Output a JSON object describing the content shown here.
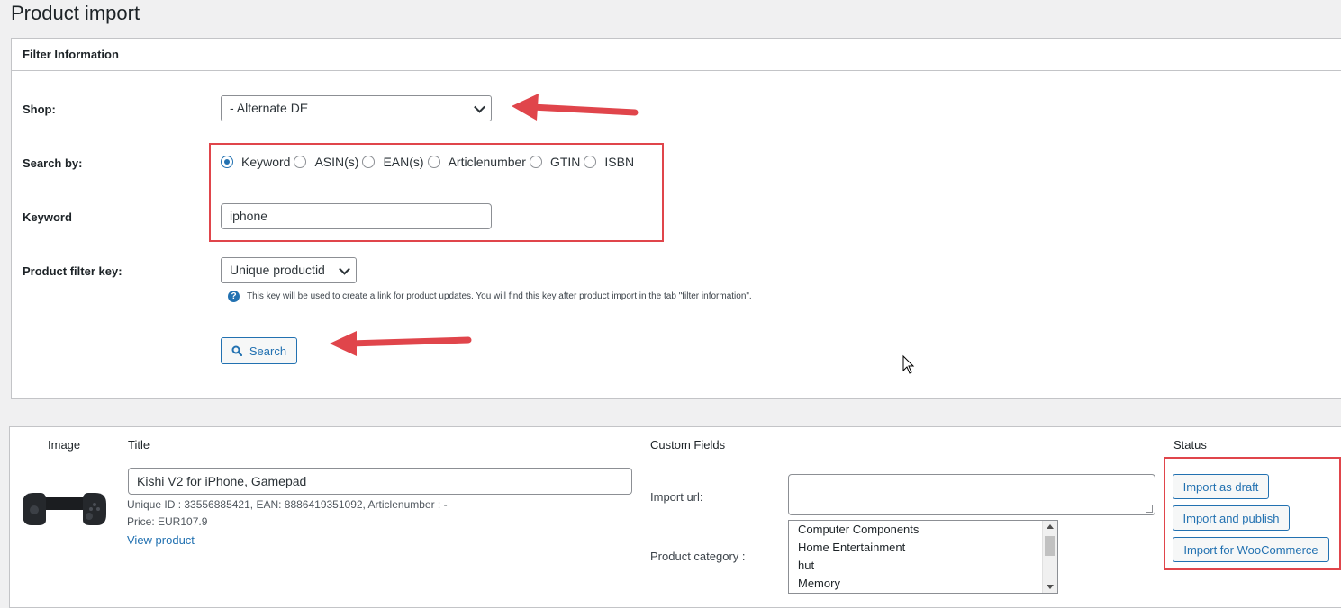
{
  "page": {
    "title": "Product import"
  },
  "filter": {
    "header": "Filter Information",
    "shop_label": "Shop:",
    "shop_value": "- Alternate DE",
    "search_by_label": "Search by:",
    "search_options": [
      {
        "label": "Keyword",
        "checked": true
      },
      {
        "label": "ASIN(s)",
        "checked": false
      },
      {
        "label": "EAN(s)",
        "checked": false
      },
      {
        "label": "Articlenumber",
        "checked": false
      },
      {
        "label": "GTIN",
        "checked": false
      },
      {
        "label": "ISBN",
        "checked": false
      }
    ],
    "keyword_label": "Keyword",
    "keyword_value": "iphone",
    "filter_key_label": "Product filter key:",
    "filter_key_value": "Unique productid",
    "help_icon": "?",
    "help_text": "This key will be used to create a link for product updates. You will find this key after product import in the tab \"filter information\".",
    "search_button": "Search"
  },
  "results": {
    "columns": {
      "image": "Image",
      "title": "Title",
      "custom_fields": "Custom Fields",
      "status": "Status"
    },
    "product": {
      "title_value": "Kishi V2 for iPhone, Gamepad",
      "meta": "Unique ID : 33556885421, EAN: 8886419351092, Articlenumber : -",
      "price": "Price: EUR107.9",
      "view_link": "View product",
      "import_url_label": "Import url:",
      "category_label": "Product category :",
      "categories": [
        "Computer Components",
        "Home Entertainment",
        "hut",
        "Memory"
      ],
      "actions": [
        "Import as draft",
        "Import and publish",
        "Import for WooCommerce"
      ]
    }
  },
  "colors": {
    "accent": "#2271b1",
    "annotation": "#e0454b"
  }
}
